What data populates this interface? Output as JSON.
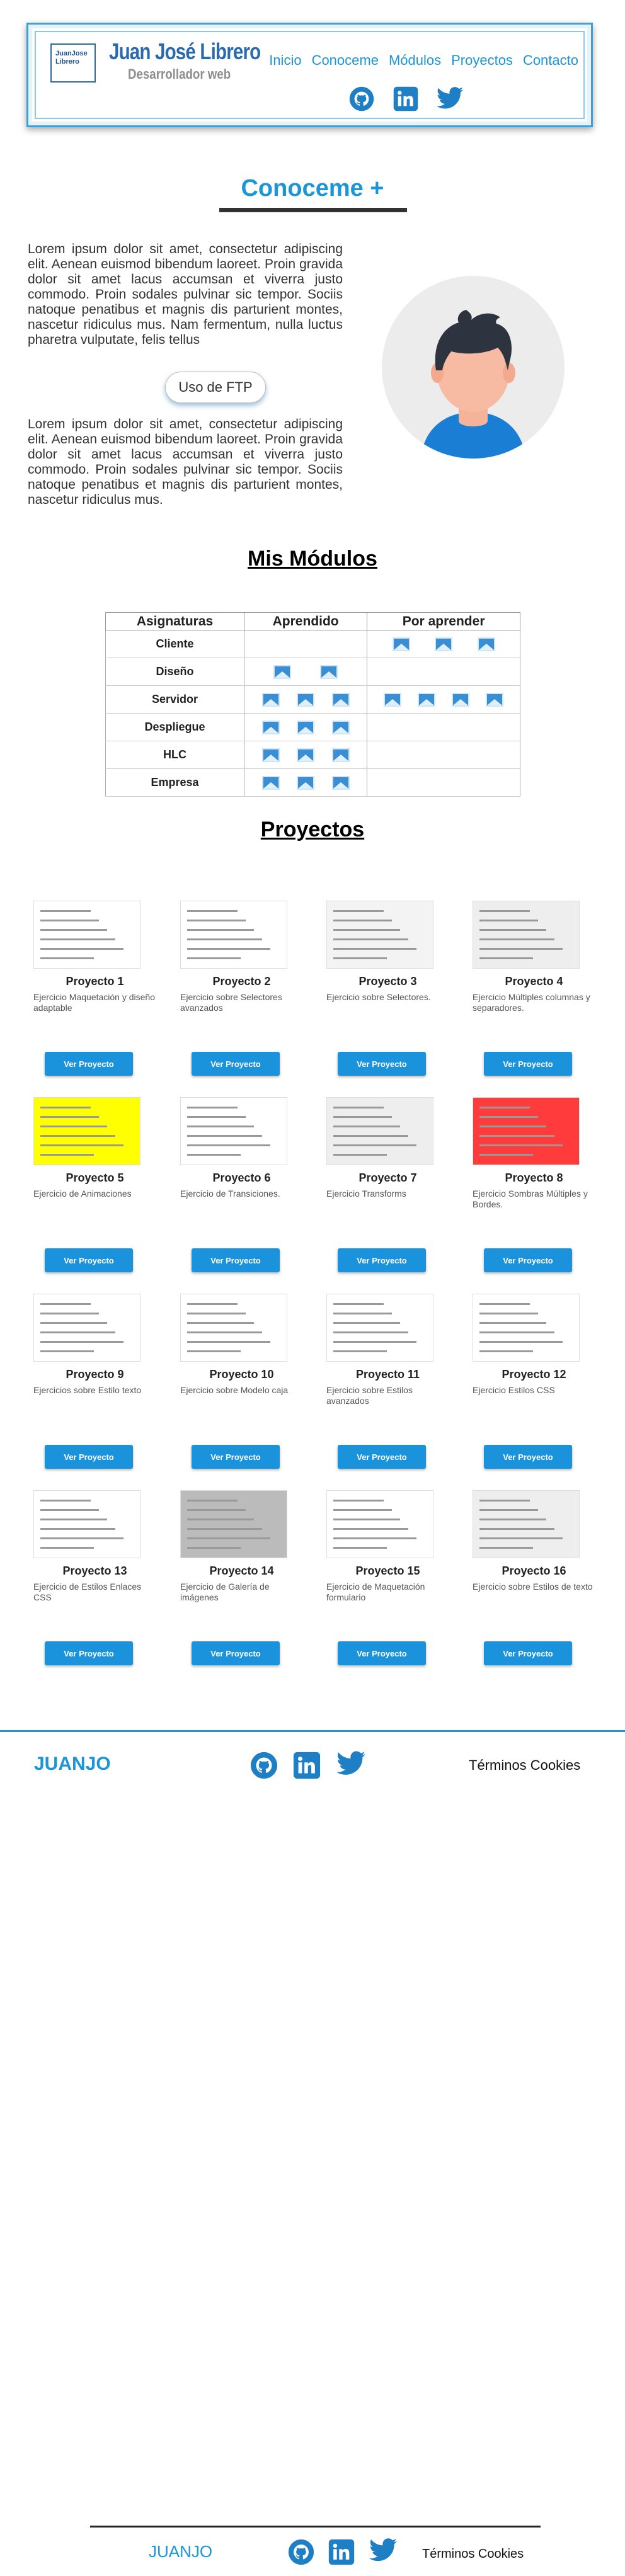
{
  "header": {
    "logo_line1": "JuanJose",
    "logo_line2": "Librero",
    "brand_name": "Juan José Librero",
    "brand_sub": "Desarrollador web",
    "nav": [
      "Inicio",
      "Conoceme",
      "Módulos",
      "Proyectos",
      "Contacto"
    ],
    "social_icons": [
      "github-icon",
      "linkedin-icon",
      "twitter-icon"
    ]
  },
  "about": {
    "title": "Conoceme +",
    "para1": "Lorem ipsum dolor sit amet, consectetur adipiscing elit. Aenean euismod bibendum laoreet. Proin gravida dolor sit amet lacus accumsan et viverra justo commodo. Proin sodales pulvinar sic tempor. Sociis natoque penatibus et magnis dis parturient montes, nascetur ridiculus mus. Nam fermentum, nulla luctus pharetra vulputate, felis tellus",
    "ftp_button": "Uso de FTP",
    "para2": "Lorem ipsum dolor sit amet, consectetur adipiscing elit. Aenean euismod bibendum laoreet. Proin gravida dolor sit amet lacus accumsan et viverra justo commodo. Proin sodales pulvinar sic tempor. Sociis natoque penatibus et magnis dis parturient montes, nascetur ridiculus mus."
  },
  "modules": {
    "title": "Mis Módulos",
    "headers": [
      "Asignaturas",
      "Aprendido",
      "Por aprender"
    ],
    "rows": [
      {
        "name": "Cliente",
        "learned": 0,
        "to_learn": 3
      },
      {
        "name": "Diseño",
        "learned": 2,
        "to_learn": 0
      },
      {
        "name": "Servidor",
        "learned": 3,
        "to_learn": 4
      },
      {
        "name": "Despliegue",
        "learned": 3,
        "to_learn": 0
      },
      {
        "name": "HLC",
        "learned": 3,
        "to_learn": 0
      },
      {
        "name": "Empresa",
        "learned": 3,
        "to_learn": 0
      }
    ]
  },
  "projects": {
    "title": "Proyectos",
    "button_label": "Ver Proyecto",
    "items": [
      {
        "title": "Proyecto 1",
        "desc": "Ejercicio Maquetación y diseño adaptable"
      },
      {
        "title": "Proyecto 2",
        "desc": "Ejercicio sobre Selectores avanzados"
      },
      {
        "title": "Proyecto 3",
        "desc": "Ejercicio sobre Selectores."
      },
      {
        "title": "Proyecto 4",
        "desc": "Ejercicio Múltiples columnas y separadores."
      },
      {
        "title": "Proyecto 5",
        "desc": "Ejercicio de Animaciones"
      },
      {
        "title": "Proyecto 6",
        "desc": "Ejercicio de Transiciones."
      },
      {
        "title": "Proyecto 7",
        "desc": "Ejercicio Transforms"
      },
      {
        "title": "Proyecto 8",
        "desc": "Ejercicio Sombras Múltiples y Bordes."
      },
      {
        "title": "Proyecto 9",
        "desc": "Ejercicios sobre Estilo texto"
      },
      {
        "title": "Proyecto 10",
        "desc": "Ejercicio sobre Modelo caja"
      },
      {
        "title": "Proyecto 11",
        "desc": "Ejercicio sobre Estilos avanzados"
      },
      {
        "title": "Proyecto 12",
        "desc": "Ejercicio Estilos CSS"
      },
      {
        "title": "Proyecto 13",
        "desc": "Ejercicio de Estilos Enlaces CSS"
      },
      {
        "title": "Proyecto 14",
        "desc": "Ejercicio de Galería de imágenes"
      },
      {
        "title": "Proyecto 15",
        "desc": "Ejercicio de Maquetación formulario"
      },
      {
        "title": "Proyecto 16",
        "desc": "Ejercicio sobre Estilos de texto"
      }
    ]
  },
  "footer": {
    "brand": "JUANJO",
    "cookies": "Términos Cookies"
  },
  "colors": {
    "accent": "#1a96d9",
    "button": "#1b93dc"
  }
}
